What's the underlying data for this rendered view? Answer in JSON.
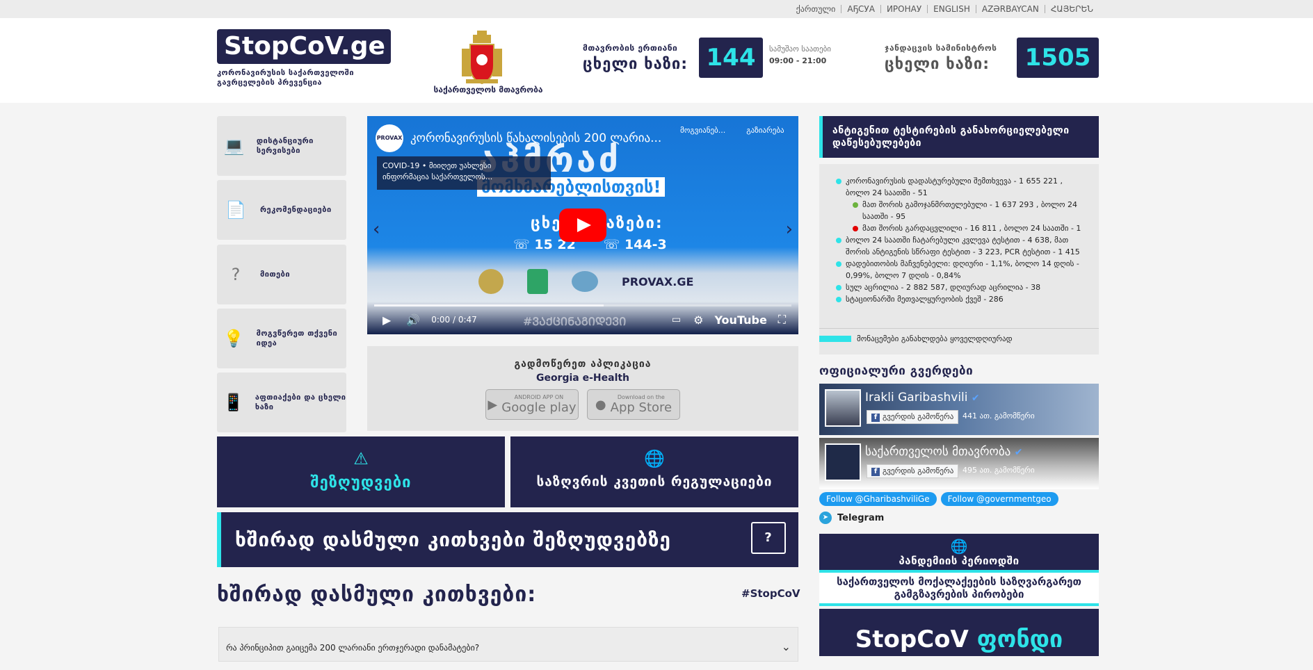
{
  "topbar": {
    "languages": [
      "ქართული",
      "АҔСУА",
      "ИРОНАУ",
      "ENGLISH",
      "AZƏRBAYCAN",
      "ՀԱՅԵՐԵՆ"
    ]
  },
  "header": {
    "logo_text": "StopCoV.ge",
    "logo_subtitle": "კორონავირუსის საქართველოში გავრცელების პრევენცია",
    "coat_label": "საქართველოს მთავრობა",
    "hotline1_small": "მთავრობის ერთიანი",
    "hotline1_big": "ცხელი ხაზი:",
    "hotline1_number": "144",
    "hours_label": "სამუშაო საათები",
    "hours_value": "09:00 - 21:00",
    "hotline2_small": "ჯანდაცვის სამინისტროს",
    "hotline2_big": "ცხელი ხაზი:",
    "hotline2_number": "1505"
  },
  "menu": [
    {
      "label": "დისტანციური სერვისები",
      "icon": "laptop-icon"
    },
    {
      "label": "რეკომენდაციები",
      "icon": "document-icon"
    },
    {
      "label": "მითები",
      "icon": "question-icon"
    },
    {
      "label": "მოგვწერეთ თქვენი იდეა",
      "icon": "lightbulb-icon"
    },
    {
      "label": "აფთიაქები და ცხელი ხაზი",
      "icon": "phone-icon"
    }
  ],
  "video": {
    "title": "კორონავირუსის წახალისების 200 ლარია...",
    "channel": "PROVAX",
    "card_line1": "COVID-19 • მიიღეთ უახლესი",
    "card_line2": "ინფორმაცია საქართველოს...",
    "watch_later": "მოგვიანებ...",
    "share": "გაზიარება",
    "overlay_big": "აჰმრაძ",
    "overlay_sub": "მომხმარებლისთვის!",
    "hotlines_label": "ცხელი ხაზები:",
    "phone1": "15 22",
    "phone2": "144-3",
    "provax": "PROVAX.GE",
    "hashtag": "#ᲕᲐᲥᲪᲘᲜᲐᲒᲘᲓᲔᲕᲘ",
    "time": "0:00 / 0:47",
    "youtube": "YouTube"
  },
  "app": {
    "title": "გადმოწერეთ აპლიკაცია",
    "name": "Georgia e-Health",
    "google_small": "ANDROID APP ON",
    "google": "Google play",
    "apple_small": "Download on the",
    "apple": "App Store"
  },
  "tiles": {
    "restrictions": "შეზღუდვები",
    "border": "საზღვრის კვეთის რეგულაციები"
  },
  "faq": {
    "banner": "ხშირად დასმული კითხვები შეზღუდვებზე",
    "title": "ხშირად დასმული კითხვები:",
    "tag": "#StopCoV",
    "first_question": "რა პრინციპით გაიცემა 200 ლარიანი ერთჯერადი დანამატები?"
  },
  "stats": {
    "header": "ანტიგენით ტესტირების განახორციელებელი დაწესებულებები",
    "items": [
      {
        "text": "კორონავირუსის დადასტურებული შემთხვევა - 1 655 221 , ბოლო 24 საათში - 51",
        "type": "main"
      },
      {
        "text": "მათ შორის გამოჯანმრთელებული - 1 637 293 , ბოლო 24 საათში - 95",
        "type": "green"
      },
      {
        "text": "მათ შორის გარდაცვლილი - 16 811 , ბოლო 24 საათში - 1",
        "type": "red"
      },
      {
        "text": "ბოლო 24 საათში ჩატარებული კვლევა ტესტით - 4 638, მათ შორის ანტიგენის სწრაფი ტესტით - 3 223, PCR ტესტით - 1 415",
        "type": "main"
      },
      {
        "text": "დადებითობის მაჩვენებელი: დღიური - 1,1%, ბოლო 14 დღის - 0,99%, ბოლო 7 დღის - 0,84%",
        "type": "main"
      },
      {
        "text": "სულ აცრილია - 2 882 587, დღიურად აცრილია - 38",
        "type": "main"
      },
      {
        "text": "სტაციონარში მეთვალყურეობის ქვეშ - 286",
        "type": "main"
      }
    ],
    "note": "მონაცემები განახლდება ყოველდღიურად"
  },
  "official": {
    "title": "ოფიციალური გვერდები",
    "pages": [
      {
        "name": "Irakli Garibashvili",
        "follow": "გვერდის გამოწერა",
        "count": "441 ათ. გამომწერი"
      },
      {
        "name": "საქართველოს მთავრობა",
        "follow": "გვერდის გამოწერა",
        "count": "495 ათ. გამომწერი"
      }
    ],
    "twitter1": "Follow @GharibashviliGe",
    "twitter2": "Follow @governmentgeo",
    "telegram": "Telegram"
  },
  "pandemic": {
    "line1": "პანდემიის პერიოდში",
    "line2": "საქართველოს მოქალაქეების საზღვარგარეთ გამგზავრების პირობები"
  },
  "fund": {
    "part1": "StopCoV",
    "part2": "ფონდი"
  },
  "colors": {
    "navy": "#23244d",
    "cyan": "#2ee3e8"
  }
}
